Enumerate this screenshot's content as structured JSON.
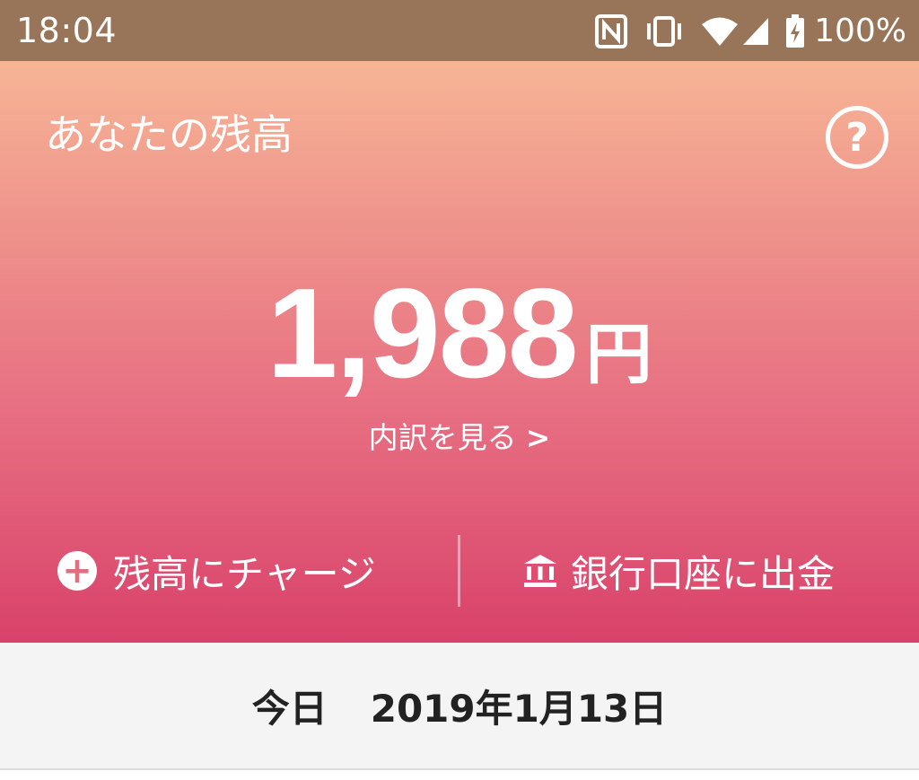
{
  "status_bar": {
    "time": "18:04",
    "battery": "100%",
    "icons": [
      "nfc-icon",
      "vibrate-icon",
      "wifi-icon",
      "signal-icon",
      "battery-icon"
    ]
  },
  "balance": {
    "title": "あなたの残高",
    "help_label": "?",
    "amount": "1,988",
    "unit": "円",
    "breakdown_link": "内訳を見る",
    "breakdown_chevron": ">"
  },
  "actions": {
    "charge_label": "残高にチャージ",
    "withdraw_label": "銀行口座に出金"
  },
  "date_header": {
    "today_label": "今日",
    "date": "2019年1月13日"
  },
  "colors": {
    "status_bar": "#987559",
    "gradient_top": "#f7b595",
    "gradient_bottom": "#d9426a",
    "date_bg": "#f4f4f4"
  }
}
